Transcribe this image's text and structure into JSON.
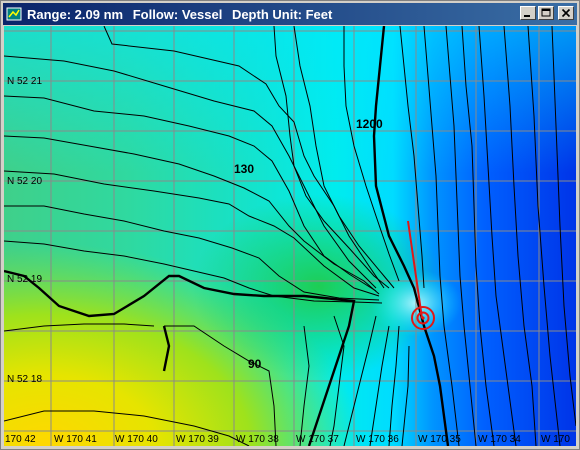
{
  "window": {
    "range_text": "Range: 2.09 nm",
    "follow_text": "Follow: Vessel",
    "depth_unit_text": "Depth Unit: Feet"
  },
  "icons": [
    "app-icon",
    "minimize-icon",
    "maximize-icon",
    "close-icon"
  ],
  "map": {
    "lat_labels": [
      "N 52 21",
      "N 52 20",
      "N 52 19",
      "N 52 18"
    ],
    "lon_labels": [
      "170 42",
      "W 170 41",
      "W 170 40",
      "W 170 39",
      "W 170 38",
      "W 170 37",
      "W 170 36",
      "W 170 35",
      "W 170 34",
      "W 170"
    ],
    "depth_labels": [
      "1200",
      "130",
      "90"
    ],
    "colors": {
      "shallow": "#ffd400",
      "mid": "#4cd84c",
      "teal": "#1ad6c6",
      "cyan": "#00f0ff",
      "deep": "#0036f0",
      "contour": "#000000",
      "vessel": "#e01818",
      "grid": "#8a8a8a"
    }
  }
}
